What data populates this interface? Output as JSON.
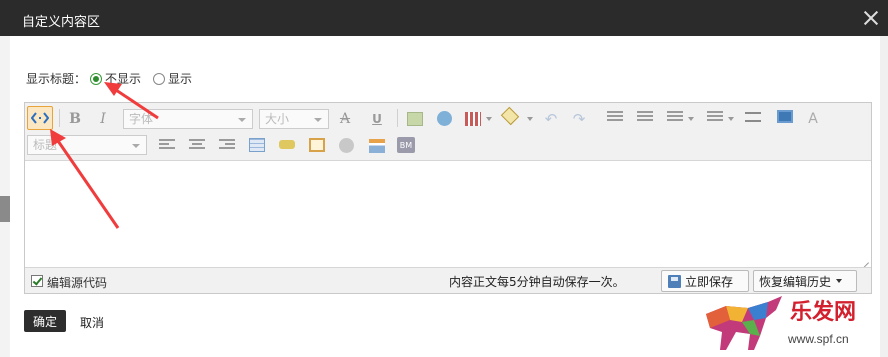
{
  "window": {
    "title": "自定义内容区",
    "close_icon": "close-icon"
  },
  "title_row": {
    "label": "显示标题：",
    "options": [
      {
        "label": "不显示",
        "selected": true
      },
      {
        "label": "显示",
        "selected": false
      }
    ]
  },
  "toolbar": {
    "font_placeholder": "字体",
    "size_placeholder": "大小",
    "heading_placeholder": "标题",
    "icons": [
      "source-code-icon",
      "bold-icon",
      "italic-icon",
      "strikethrough-icon",
      "underline-icon",
      "image-icon",
      "emoticon-icon",
      "table-icon",
      "fill-color-icon",
      "undo-icon",
      "redo-icon",
      "indent-icon",
      "outdent-icon",
      "bullet-list-icon",
      "numbered-list-icon",
      "horizontal-rule-icon",
      "video-icon",
      "clear-format-icon",
      "align-left-icon",
      "align-center-icon",
      "align-right-icon",
      "grid-icon",
      "glasses-icon",
      "frame-icon",
      "flash-icon",
      "widget-icon",
      "bm-icon"
    ],
    "bm_text": "BM",
    "bold_text": "B",
    "italic_text": "I",
    "strike_text": "A",
    "underline_text": "U"
  },
  "editor": {
    "content": ""
  },
  "statusbar": {
    "source_checkbox_label": "编辑源代码",
    "source_checked": true,
    "autosave_text": "内容正文每5分钟自动保存一次。",
    "save_now_label": "立即保存",
    "restore_history_label": "恢复编辑历史"
  },
  "footer": {
    "ok_label": "确定",
    "cancel_label": "取消"
  },
  "watermark": {
    "brand": "乐发网",
    "url": "www.spf.cn"
  },
  "colors": {
    "titlebar": "#2b2b2b",
    "selected_button_border": "#e8a43a",
    "annotation_arrow": "#f03c3c",
    "radio_selected": "#2e8b2e"
  }
}
